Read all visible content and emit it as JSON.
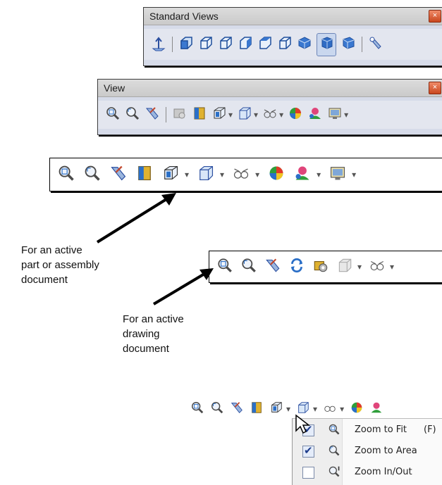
{
  "standard_views": {
    "title": "Standard Views",
    "close": "×",
    "icons": [
      "normal-to-icon",
      "front-view-icon",
      "back-view-icon",
      "left-view-icon",
      "right-view-icon",
      "top-view-icon",
      "bottom-view-icon",
      "isometric-view-icon",
      "trimetric-view-icon",
      "dimetric-view-icon",
      "view-selector-icon"
    ]
  },
  "view_toolbar": {
    "title": "View",
    "close": "×",
    "icons": [
      "zoom-to-fit-icon",
      "zoom-to-area-icon",
      "previous-view-icon",
      "redraw-icon",
      "section-view-icon",
      "view-orientation-icon",
      "display-style-icon",
      "hide-show-items-icon",
      "edit-appearance-icon",
      "apply-scene-icon",
      "view-settings-icon"
    ]
  },
  "part_toolbar": {
    "icons": [
      "zoom-to-fit-icon",
      "zoom-to-area-icon",
      "previous-view-icon",
      "section-view-icon",
      "view-orientation-icon",
      "display-style-icon",
      "hide-show-items-icon",
      "edit-appearance-icon",
      "apply-scene-icon",
      "view-settings-icon"
    ]
  },
  "drawing_toolbar": {
    "icons": [
      "zoom-to-fit-icon",
      "zoom-to-area-icon",
      "previous-view-icon",
      "rebuild-icon",
      "redraw-icon",
      "display-style-icon",
      "hide-show-items-icon"
    ]
  },
  "labels": {
    "part": "For an active\npart or assembly\ndocument",
    "drawing": "For an active\ndrawing\ndocument"
  },
  "menu": {
    "items": [
      {
        "label": "Zoom to Fit",
        "shortcut": "(F)",
        "checked": true
      },
      {
        "label": "Zoom to Area",
        "shortcut": "",
        "checked": true
      },
      {
        "label": "Zoom In/Out",
        "shortcut": "",
        "checked": false
      }
    ]
  },
  "colors": {
    "toolwin_bg": "#d6dbe9",
    "accent_blue": "#2b6fc7",
    "close_red": "#d9532b"
  }
}
